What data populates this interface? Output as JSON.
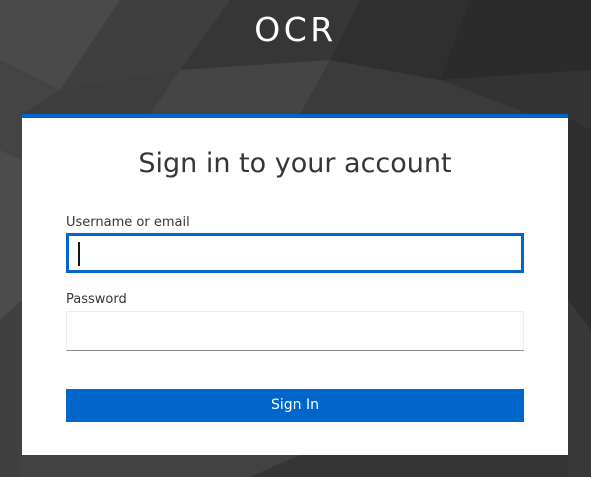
{
  "brand": {
    "name": "OCR"
  },
  "login": {
    "title": "Sign in to your account",
    "username_label": "Username or email",
    "username_value": "",
    "password_label": "Password",
    "password_value": "",
    "submit_label": "Sign In"
  },
  "colors": {
    "accent": "#0066cc",
    "background": "#3a3a3a",
    "card": "#ffffff",
    "text": "#363636"
  },
  "icons": [
    "text-caret-icon"
  ]
}
